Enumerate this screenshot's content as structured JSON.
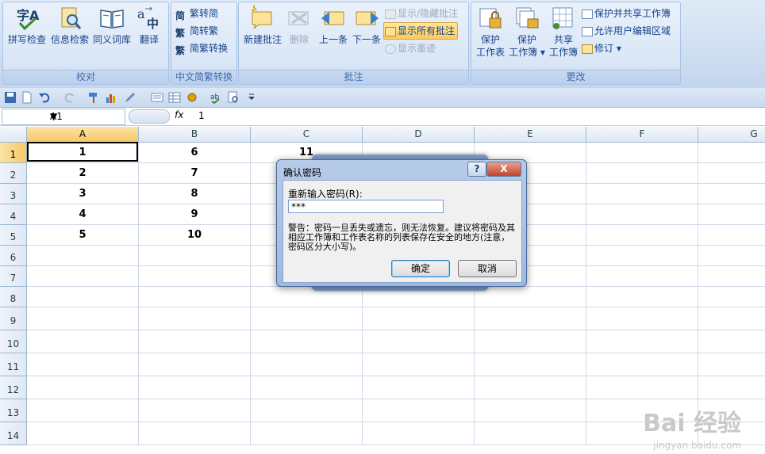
{
  "ribbon": {
    "groups": {
      "proofing": "校对",
      "chinese": "中文简繁转换",
      "comments": "批注",
      "changes": "更改"
    },
    "proofing": {
      "spell": "拼写检查",
      "research": "信息检索",
      "thesaurus": "同义词库",
      "translate": "翻译"
    },
    "chinese": {
      "to_simplified": "繁转简",
      "to_traditional": "简转繁",
      "convert": "简繁转换"
    },
    "comments": {
      "new": "新建批注",
      "delete": "删除",
      "prev": "上一条",
      "next": "下一条",
      "show_hide": "显示/隐藏批注",
      "show_all": "显示所有批注",
      "show_ink": "显示墨迹"
    },
    "changes": {
      "protect_sheet_1": "保护",
      "protect_sheet_2": "工作表",
      "protect_book_1": "保护",
      "protect_book_2": "工作簿",
      "share_1": "共享",
      "share_2": "工作簿",
      "protect_share": "保护并共享工作簿",
      "allow_edit": "允许用户编辑区域",
      "track": "修订"
    }
  },
  "formula_bar": {
    "name_box": "A1",
    "fx": "fx",
    "value": "1"
  },
  "grid": {
    "columns": [
      "A",
      "B",
      "C",
      "D",
      "E",
      "F",
      "G"
    ],
    "rows": [
      "1",
      "2",
      "3",
      "4",
      "5",
      "6",
      "7",
      "8",
      "9",
      "10",
      "11",
      "12",
      "13",
      "14"
    ],
    "data": [
      [
        "1",
        "6",
        "11"
      ],
      [
        "2",
        "7",
        ""
      ],
      [
        "3",
        "8",
        ""
      ],
      [
        "4",
        "9",
        ""
      ],
      [
        "5",
        "10",
        ""
      ]
    ]
  },
  "dialog": {
    "title": "确认密码",
    "help": "?",
    "close": "X",
    "label": "重新输入密码(R):",
    "value": "***",
    "warning": "警告：密码一旦丢失或遗忘，则无法恢复。建议将密码及其相应工作簿和工作表名称的列表保存在安全的地方(注意，密码区分大小写)。",
    "ok": "确定",
    "cancel": "取消"
  },
  "watermark": {
    "brand": "Bai 经验",
    "url": "jingyan.baidu.com"
  }
}
